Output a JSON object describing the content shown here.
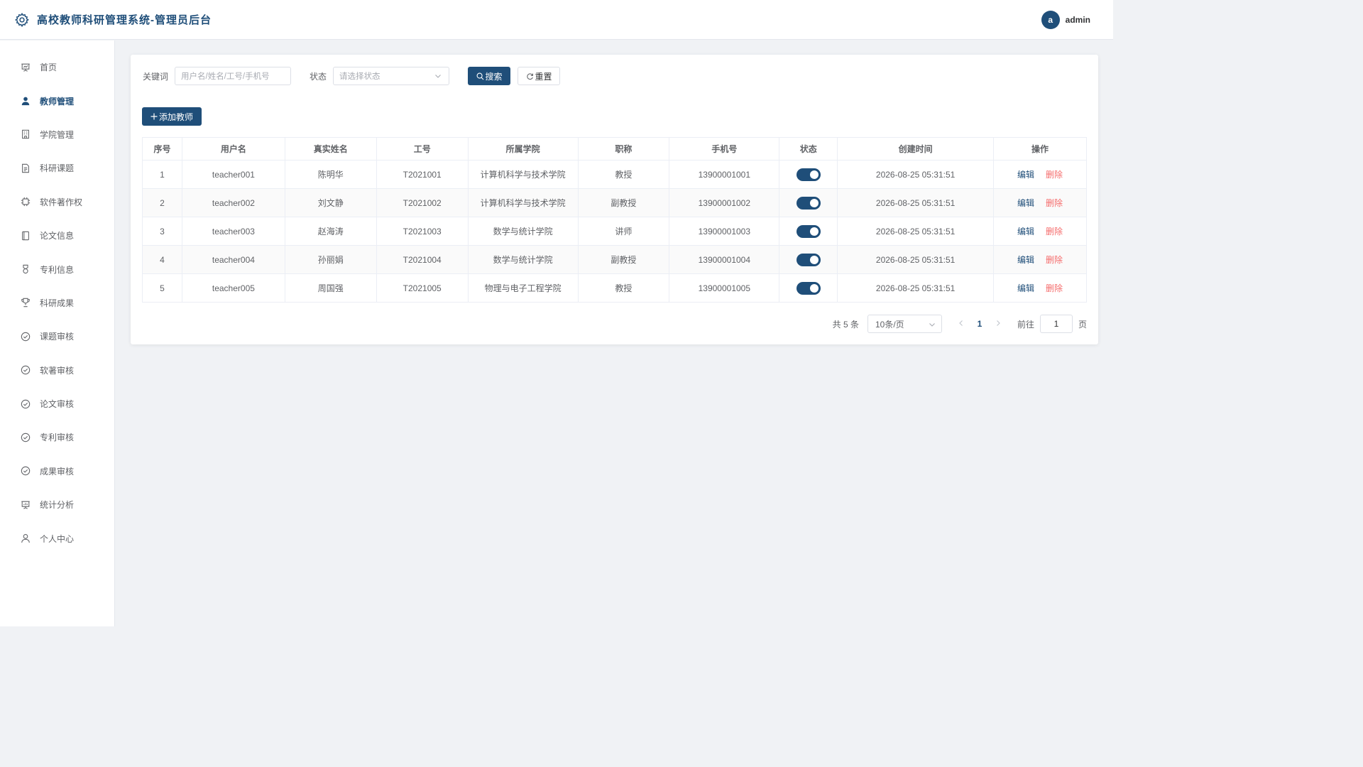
{
  "app": {
    "title": "高校教师科研管理系统-管理员后台"
  },
  "user": {
    "avatar_letter": "a",
    "name": "admin"
  },
  "sidebar": {
    "items": [
      {
        "label": "首页",
        "icon": "presentation-icon"
      },
      {
        "label": "教师管理",
        "icon": "user-icon",
        "active": true
      },
      {
        "label": "学院管理",
        "icon": "building-icon"
      },
      {
        "label": "科研课题",
        "icon": "document-icon"
      },
      {
        "label": "软件著作权",
        "icon": "cpu-icon"
      },
      {
        "label": "论文信息",
        "icon": "notebook-icon"
      },
      {
        "label": "专利信息",
        "icon": "medal-icon"
      },
      {
        "label": "科研成果",
        "icon": "trophy-icon"
      },
      {
        "label": "课题审核",
        "icon": "check-circle-icon"
      },
      {
        "label": "软著审核",
        "icon": "check-circle-icon"
      },
      {
        "label": "论文审核",
        "icon": "check-circle-icon"
      },
      {
        "label": "专利审核",
        "icon": "check-circle-icon"
      },
      {
        "label": "成果审核",
        "icon": "check-circle-icon"
      },
      {
        "label": "统计分析",
        "icon": "data-board-icon"
      },
      {
        "label": "个人中心",
        "icon": "user-outline-icon"
      }
    ]
  },
  "filter": {
    "keyword_label": "关键词",
    "keyword_placeholder": "用户名/姓名/工号/手机号",
    "status_label": "状态",
    "status_placeholder": "请选择状态",
    "search_label": "搜索",
    "reset_label": "重置"
  },
  "toolbar": {
    "add_label": "添加教师"
  },
  "table": {
    "columns": [
      "序号",
      "用户名",
      "真实姓名",
      "工号",
      "所属学院",
      "职称",
      "手机号",
      "状态",
      "创建时间",
      "操作"
    ],
    "rows": [
      {
        "index": "1",
        "username": "teacher001",
        "name": "陈明华",
        "job_no": "T2021001",
        "college": "计算机科学与技术学院",
        "title": "教授",
        "phone": "13900001001",
        "enabled": true,
        "created": "2026-08-25 05:31:51"
      },
      {
        "index": "2",
        "username": "teacher002",
        "name": "刘文静",
        "job_no": "T2021002",
        "college": "计算机科学与技术学院",
        "title": "副教授",
        "phone": "13900001002",
        "enabled": true,
        "created": "2026-08-25 05:31:51"
      },
      {
        "index": "3",
        "username": "teacher003",
        "name": "赵海涛",
        "job_no": "T2021003",
        "college": "数学与统计学院",
        "title": "讲师",
        "phone": "13900001003",
        "enabled": true,
        "created": "2026-08-25 05:31:51"
      },
      {
        "index": "4",
        "username": "teacher004",
        "name": "孙丽娟",
        "job_no": "T2021004",
        "college": "数学与统计学院",
        "title": "副教授",
        "phone": "13900001004",
        "enabled": true,
        "created": "2026-08-25 05:31:51"
      },
      {
        "index": "5",
        "username": "teacher005",
        "name": "周国强",
        "job_no": "T2021005",
        "college": "物理与电子工程学院",
        "title": "教授",
        "phone": "13900001005",
        "enabled": true,
        "created": "2026-08-25 05:31:51"
      }
    ],
    "edit_label": "编辑",
    "delete_label": "删除"
  },
  "pagination": {
    "total_text": "共 5 条",
    "page_size": "10条/页",
    "current_page": "1",
    "goto_label": "前往",
    "goto_value": "1",
    "page_suffix": "页"
  },
  "colors": {
    "primary": "#1f4e79",
    "danger": "#f56c6c",
    "background": "#f0f2f5"
  }
}
